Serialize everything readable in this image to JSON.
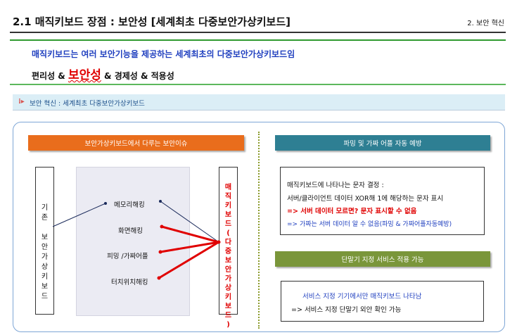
{
  "slide": {
    "title": "2.1 매직키보드 장점 : 보안성 [세계최초 다중보안가상키보드]",
    "section_label": "2. 보안 혁신",
    "headline": "매직키보드는 여러 보안기능을 제공하는 세계최초의 다중보안가상키보드임",
    "subline_pre": "편리성  &  ",
    "subline_hl": "보안성",
    "subline_post": " & 경제성 & 적용성"
  },
  "bar": {
    "icon": "bullet-arrow-icon",
    "text": "보안 혁신 : 세계최초  다중보안가상키보드"
  },
  "left_panel": {
    "header": "보안가상키보드에서  다루는  보안이슈",
    "left_label": "기존 보안가상키보드",
    "right_label": "매직키보드(다중보안가상키보드)",
    "items": [
      "메모리해킹",
      "화면해킹",
      "피밍 /가짜어플",
      "터치위치해킹"
    ]
  },
  "right_panel": {
    "header1": "파밍 및 가짜 어플 자동 예방",
    "info1": {
      "line1": "매직키보드에 나타나는 문자 결정 :",
      "line2": "서버/클라이언트 데이터 XOR해 1에 해당하는 문자 표시",
      "line3": "=> 서버 데이터 모르면? 문자 표시할 수 없음",
      "line4": "=>  가짜는 서버 데이터 알 수 없음(파밍 & 가짜어플자동예방)"
    },
    "header2": "단말기 지정 서비스 적용 가능",
    "info2": {
      "line1": "서비스  지정  기기에서만  매직키보드  나타남",
      "line2": "=> 서비스 지정 단말기 외안 확인 가능"
    }
  },
  "colors": {
    "title_rule": "#333333",
    "green_rule": "#2f9a2f",
    "orange_header": "#e96d1c",
    "teal_header": "#2e7f93",
    "olive_header": "#7a963a",
    "red_accent": "#e00000",
    "blue_text": "#1f3fbf",
    "connector_dark": "#1a2a5a"
  }
}
